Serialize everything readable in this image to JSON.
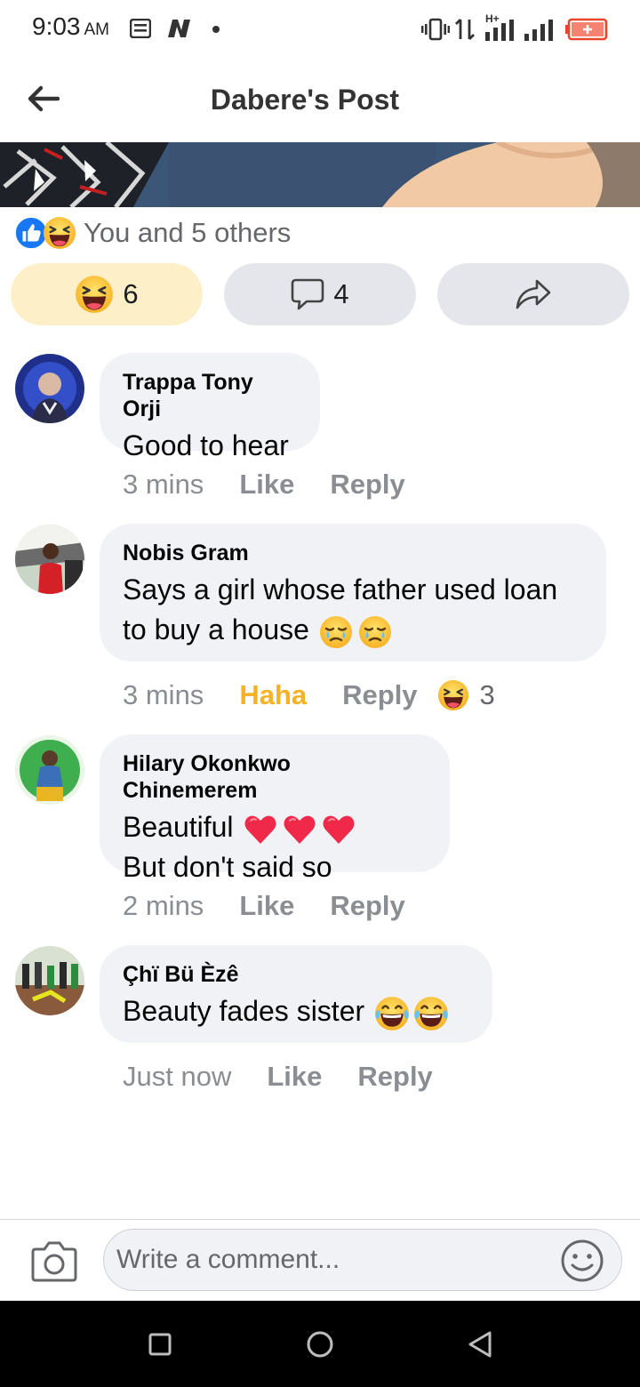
{
  "status_bar": {
    "time": "9:03",
    "ampm": "AM",
    "network_label": "H+"
  },
  "header": {
    "title": "Dabere's Post"
  },
  "reactions": {
    "summary_text": "You and 5 others",
    "haha_count": "6",
    "comment_count": "4"
  },
  "comments": [
    {
      "author": "Trappa Tony Orji",
      "lines": [
        "Good to hear"
      ],
      "time": "3 mins",
      "like_label": "Like",
      "reply_label": "Reply"
    },
    {
      "author": "Nobis Gram",
      "lines": [
        "Says a girl whose father used loan",
        "to buy a house"
      ],
      "time": "3 mins",
      "like_label": "Haha",
      "reply_label": "Reply",
      "reaction_count": "3"
    },
    {
      "author": "Hilary Okonkwo Chinemerem",
      "lines": [
        "Beautiful",
        "But don't said so"
      ],
      "time": "2 mins",
      "like_label": "Like",
      "reply_label": "Reply"
    },
    {
      "author": "Çhï Bü Èzê",
      "lines": [
        "Beauty fades sister"
      ],
      "time": "Just now",
      "like_label": "Like",
      "reply_label": "Reply"
    }
  ],
  "composer": {
    "placeholder": "Write a comment..."
  },
  "colors": {
    "haha_active": "#f7b125",
    "pill_bg": "#e4e6eb",
    "haha_pill_bg": "#fdf0c8",
    "bubble_bg": "#f0f2f5",
    "like_blue": "#1877f2",
    "heart_red": "#f02849"
  },
  "icons": [
    "back-arrow-icon",
    "like-icon",
    "haha-icon",
    "comment-icon",
    "share-icon",
    "camera-icon",
    "smiley-icon",
    "sad-tear-icon",
    "heart-icon",
    "laugh-cry-icon"
  ]
}
